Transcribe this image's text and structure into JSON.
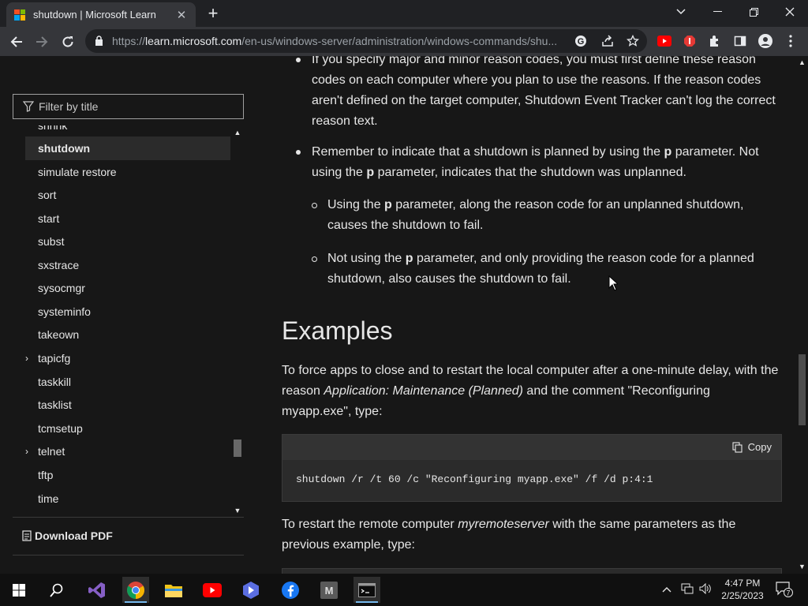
{
  "browser": {
    "tab_title": "shutdown | Microsoft Learn",
    "url_prefix": "https://",
    "url_domain": "learn.microsoft.com",
    "url_path": "/en-us/windows-server/administration/windows-commands/shu...",
    "min": "—",
    "max": "❐",
    "close": "✕"
  },
  "sidebar": {
    "filter_placeholder": "Filter by title",
    "partial_item": "shrink",
    "items": [
      {
        "label": "shutdown",
        "active": true,
        "expandable": false
      },
      {
        "label": "simulate restore",
        "expandable": false
      },
      {
        "label": "sort",
        "expandable": false
      },
      {
        "label": "start",
        "expandable": false
      },
      {
        "label": "subst",
        "expandable": false
      },
      {
        "label": "sxstrace",
        "expandable": false
      },
      {
        "label": "sysocmgr",
        "expandable": false
      },
      {
        "label": "systeminfo",
        "expandable": false
      },
      {
        "label": "takeown",
        "expandable": false
      },
      {
        "label": "tapicfg",
        "expandable": true
      },
      {
        "label": "taskkill",
        "expandable": false
      },
      {
        "label": "tasklist",
        "expandable": false
      },
      {
        "label": "tcmsetup",
        "expandable": false
      },
      {
        "label": "telnet",
        "expandable": true
      },
      {
        "label": "tftp",
        "expandable": false
      },
      {
        "label": "time",
        "expandable": false
      }
    ],
    "download_pdf": "Download PDF"
  },
  "content": {
    "bullet1": "If you specify major and minor reason codes, you must first define these reason codes on each computer where you plan to use the reasons. If the reason codes aren't defined on the target computer, Shutdown Event Tracker can't log the correct reason text.",
    "bullet2_a": "Remember to indicate that a shutdown is planned by using the ",
    "bullet2_p": "p",
    "bullet2_b": " parameter. Not using the ",
    "bullet2_p2": "p",
    "bullet2_c": " parameter, indicates that the shutdown was unplanned.",
    "sub1_a": "Using the ",
    "sub1_p": "p",
    "sub1_b": " parameter, along the reason code for an unplanned shutdown, causes the shutdown to fail.",
    "sub2_a": "Not using the ",
    "sub2_p": "p",
    "sub2_b": " parameter, and only providing the reason code for a planned shutdown, also causes the shutdown to fail.",
    "examples_heading": "Examples",
    "ex1_a": "To force apps to close and to restart the local computer after a one-minute delay, with the reason ",
    "ex1_i": "Application: Maintenance (Planned)",
    "ex1_b": " and the comment \"Reconfiguring myapp.exe\", type:",
    "copy_label": "Copy",
    "code1": "shutdown /r /t 60 /c \"Reconfiguring myapp.exe\" /f /d p:4:1",
    "ex2_a": "To restart the remote computer ",
    "ex2_i": "myremoteserver",
    "ex2_b": " with the same parameters as the previous example, type:"
  },
  "taskbar": {
    "time": "4:47 PM",
    "date": "2/25/2023",
    "notification_count": "7"
  },
  "colors": {
    "accent": "#76b9ed",
    "background": "#171717"
  }
}
